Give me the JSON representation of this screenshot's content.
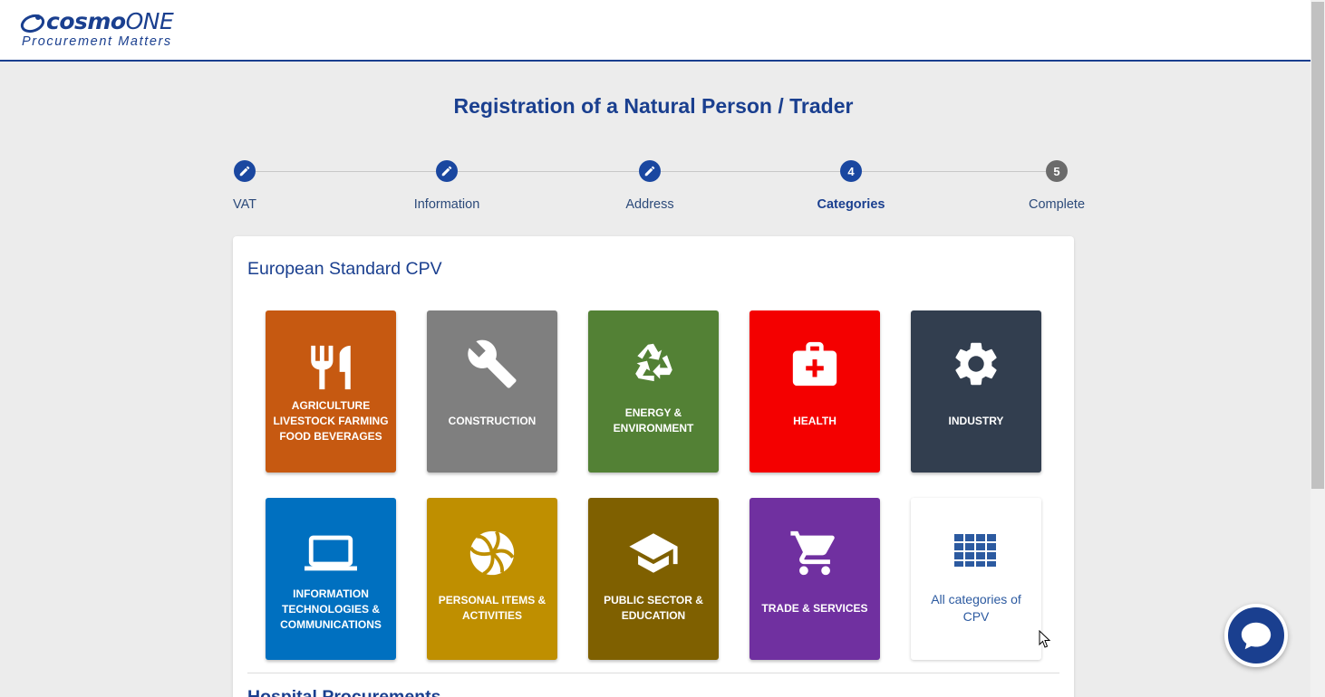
{
  "header": {
    "logo_brand": "cosmo",
    "logo_brand_bold": "ONE",
    "logo_tagline": "Procurement Matters"
  },
  "title": "Registration of a Natural Person / Trader",
  "steps": [
    {
      "label": "VAT",
      "state": "done",
      "icon": "pencil-icon"
    },
    {
      "label": "Information",
      "state": "done",
      "icon": "pencil-icon"
    },
    {
      "label": "Address",
      "state": "done",
      "icon": "pencil-icon"
    },
    {
      "label": "Categories",
      "number": "4",
      "state": "active"
    },
    {
      "label": "Complete",
      "number": "5",
      "state": "pending"
    }
  ],
  "section": {
    "title": "European Standard CPV",
    "next_title": "Hospital Procurements"
  },
  "tiles": [
    {
      "label": "AGRICULTURE LIVESTOCK FARMING FOOD BEVERAGES",
      "color": "#c65911",
      "icon": "fork-knife-icon"
    },
    {
      "label": "CONSTRUCTION",
      "color": "#7f7f7f",
      "icon": "wrench-icon"
    },
    {
      "label": "ENERGY & ENVIRONMENT",
      "color": "#538135",
      "icon": "recycle-icon"
    },
    {
      "label": "HEALTH",
      "color": "#f40000",
      "icon": "medical-kit-icon"
    },
    {
      "label": "INDUSTRY",
      "color": "#323e4f",
      "icon": "gear-icon"
    },
    {
      "label": "INFORMATION TECHNOLOGIES & COMMUNICATIONS",
      "color": "#0070c0",
      "icon": "laptop-icon"
    },
    {
      "label": "PERSONAL ITEMS & ACTIVITIES",
      "color": "#bf8f00",
      "icon": "volleyball-icon"
    },
    {
      "label": "PUBLIC SECTOR & EDUCATION",
      "color": "#7f6000",
      "icon": "graduation-cap-icon"
    },
    {
      "label": "TRADE & SERVICES",
      "color": "#7030a0",
      "icon": "shopping-cart-icon"
    },
    {
      "label": "All categories of CPV",
      "color": "#ffffff",
      "icon": "grid-icon"
    }
  ],
  "colors": {
    "brand": "#1a3f8f",
    "accent": "#1a47a0",
    "background": "#ececec"
  }
}
